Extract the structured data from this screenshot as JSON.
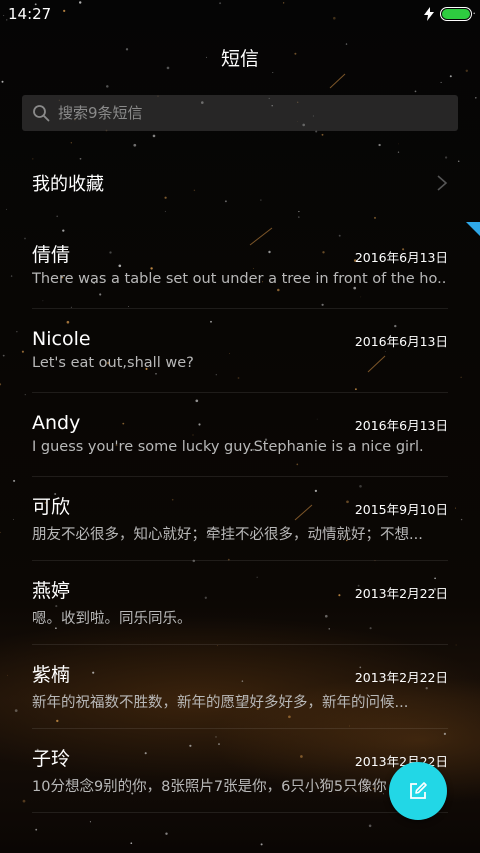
{
  "status_bar": {
    "time": "14:27",
    "battery_level": 1.0,
    "battery_color": "#2ecc40",
    "charging_icon": "lightning-bolt-icon"
  },
  "header": {
    "title": "短信"
  },
  "search": {
    "placeholder": "搜索9条短信",
    "icon": "search-icon"
  },
  "favorites": {
    "label": "我的收藏",
    "icon": "chevron-right-icon"
  },
  "conversations": [
    {
      "name": "倩倩",
      "date": "2016年6月13日",
      "preview": "There was a table set out under a tree in front of the ho.."
    },
    {
      "name": "Nicole",
      "date": "2016年6月13日",
      "preview": "Let's eat out,shall we?"
    },
    {
      "name": "Andy",
      "date": "2016年6月13日",
      "preview": "I guess you're some lucky guy.Stephanie is a nice girl."
    },
    {
      "name": "可欣",
      "date": "2015年9月10日",
      "preview": "朋友不必很多，知心就好；牵挂不必很多，动情就好；不想..."
    },
    {
      "name": "燕婷",
      "date": "2013年2月22日",
      "preview": "嗯。收到啦。同乐同乐。"
    },
    {
      "name": "紫楠",
      "date": "2013年2月22日",
      "preview": "新年的祝福数不胜数，新年的愿望好多好多，新年的问候..."
    },
    {
      "name": "子玲",
      "date": "2013年2月22日",
      "preview": "10分想念9别的你，8张照片7张是你，6只小狗5只像你"
    }
  ],
  "compose": {
    "icon": "compose-icon",
    "color": "#22d7e6"
  },
  "colors": {
    "accent": "#22d7e6",
    "side_tab": "#2fa8e8"
  }
}
